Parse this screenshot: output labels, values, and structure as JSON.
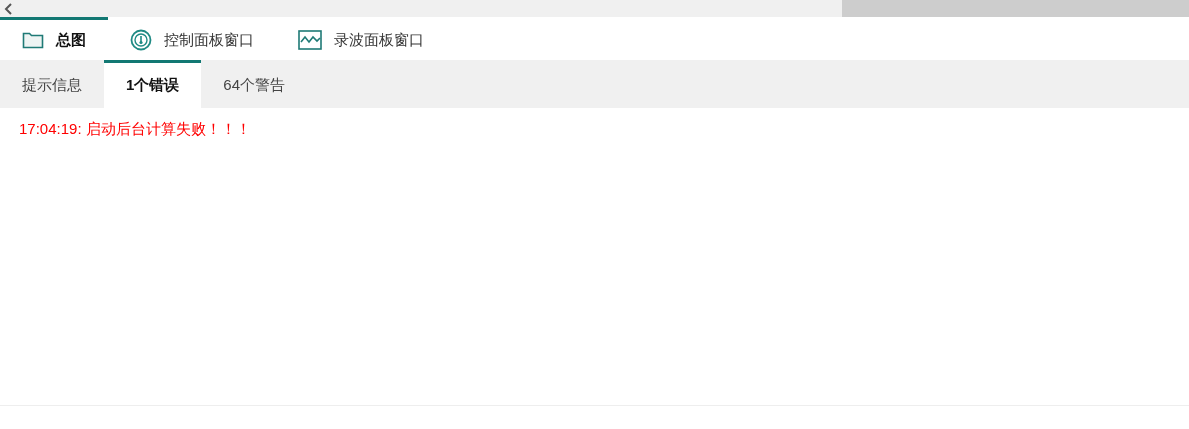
{
  "view_tabs": [
    {
      "label": "总图",
      "kind": "folder",
      "selected": true
    },
    {
      "label": "控制面板窗口",
      "kind": "gauge",
      "selected": false
    },
    {
      "label": "录波面板窗口",
      "kind": "wave",
      "selected": false
    }
  ],
  "message_tabs": [
    {
      "label": "提示信息",
      "selected": false
    },
    {
      "label": "1个错误",
      "selected": true
    },
    {
      "label": "64个警告",
      "selected": false
    }
  ],
  "messages": [
    {
      "text": "17:04:19: 启动后台计算失败！！！",
      "kind": "error"
    }
  ]
}
